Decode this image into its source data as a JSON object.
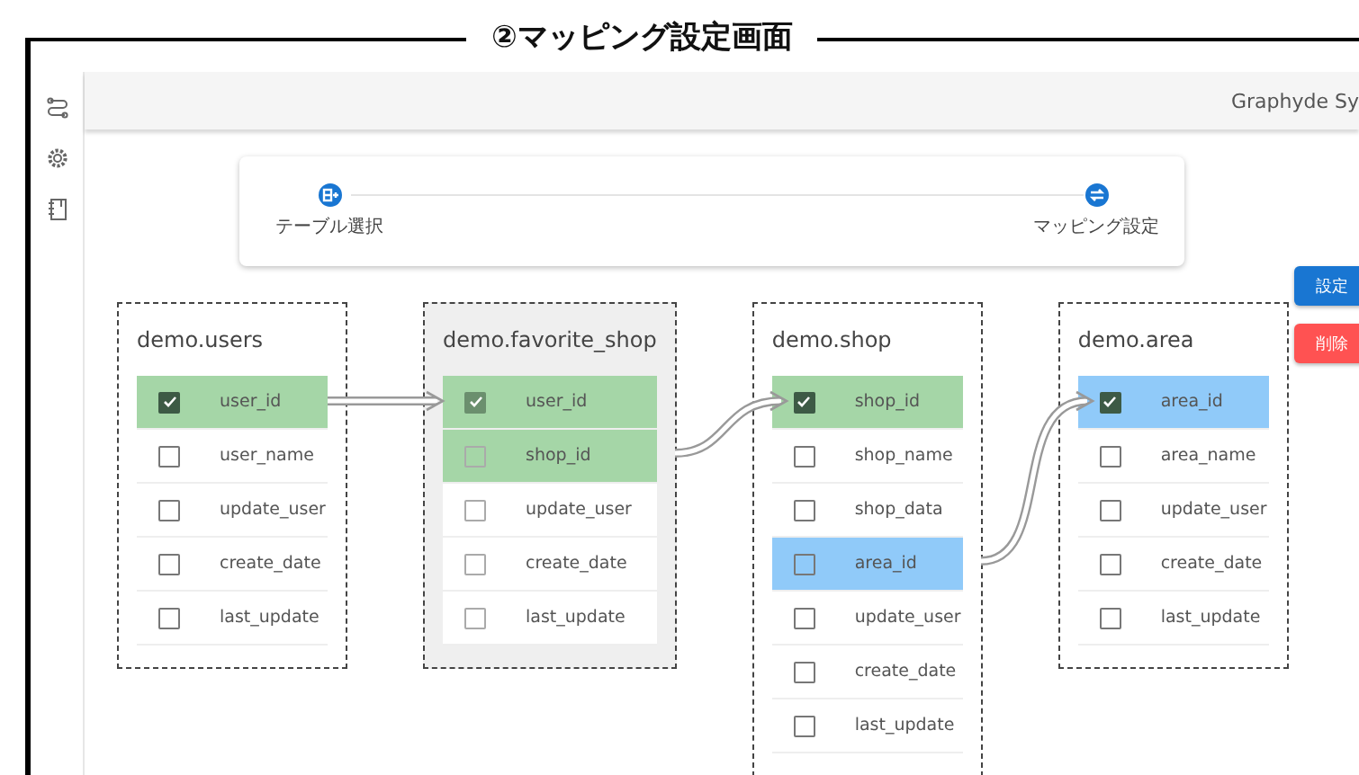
{
  "title": "②マッピング設定画面",
  "header": {
    "app_name": "Graphyde Sy"
  },
  "stepper": [
    {
      "label": "テーブル選択",
      "kind": "table"
    },
    {
      "label": "マッピング設定",
      "kind": "mapping"
    }
  ],
  "buttons": [
    {
      "label": "設定",
      "kind": "primary"
    },
    {
      "label": "削除",
      "kind": "danger"
    }
  ],
  "tables": [
    {
      "name": "demo.users",
      "disabled": false,
      "fields": [
        {
          "name": "user_id",
          "checked": true,
          "color": "#a5d6a7"
        },
        {
          "name": "user_name",
          "checked": false
        },
        {
          "name": "update_user",
          "checked": false
        },
        {
          "name": "create_date",
          "checked": false
        },
        {
          "name": "last_update",
          "checked": false
        }
      ]
    },
    {
      "name": "demo.favorite_shop",
      "disabled": true,
      "fields": [
        {
          "name": "user_id",
          "checked": true,
          "color": "#a5d6a7"
        },
        {
          "name": "shop_id",
          "checked": false,
          "color": "#a5d6a7"
        },
        {
          "name": "update_user",
          "checked": false
        },
        {
          "name": "create_date",
          "checked": false
        },
        {
          "name": "last_update",
          "checked": false
        }
      ]
    },
    {
      "name": "demo.shop",
      "disabled": false,
      "fields": [
        {
          "name": "shop_id",
          "checked": true,
          "color": "#a5d6a7"
        },
        {
          "name": "shop_name",
          "checked": false
        },
        {
          "name": "shop_data",
          "checked": false
        },
        {
          "name": "area_id",
          "checked": false,
          "color": "#90caf9"
        },
        {
          "name": "update_user",
          "checked": false
        },
        {
          "name": "create_date",
          "checked": false
        },
        {
          "name": "last_update",
          "checked": false
        }
      ]
    },
    {
      "name": "demo.area",
      "disabled": false,
      "fields": [
        {
          "name": "area_id",
          "checked": true,
          "color": "#90caf9"
        },
        {
          "name": "area_name",
          "checked": false
        },
        {
          "name": "update_user",
          "checked": false
        },
        {
          "name": "create_date",
          "checked": false
        },
        {
          "name": "last_update",
          "checked": false
        }
      ]
    }
  ]
}
